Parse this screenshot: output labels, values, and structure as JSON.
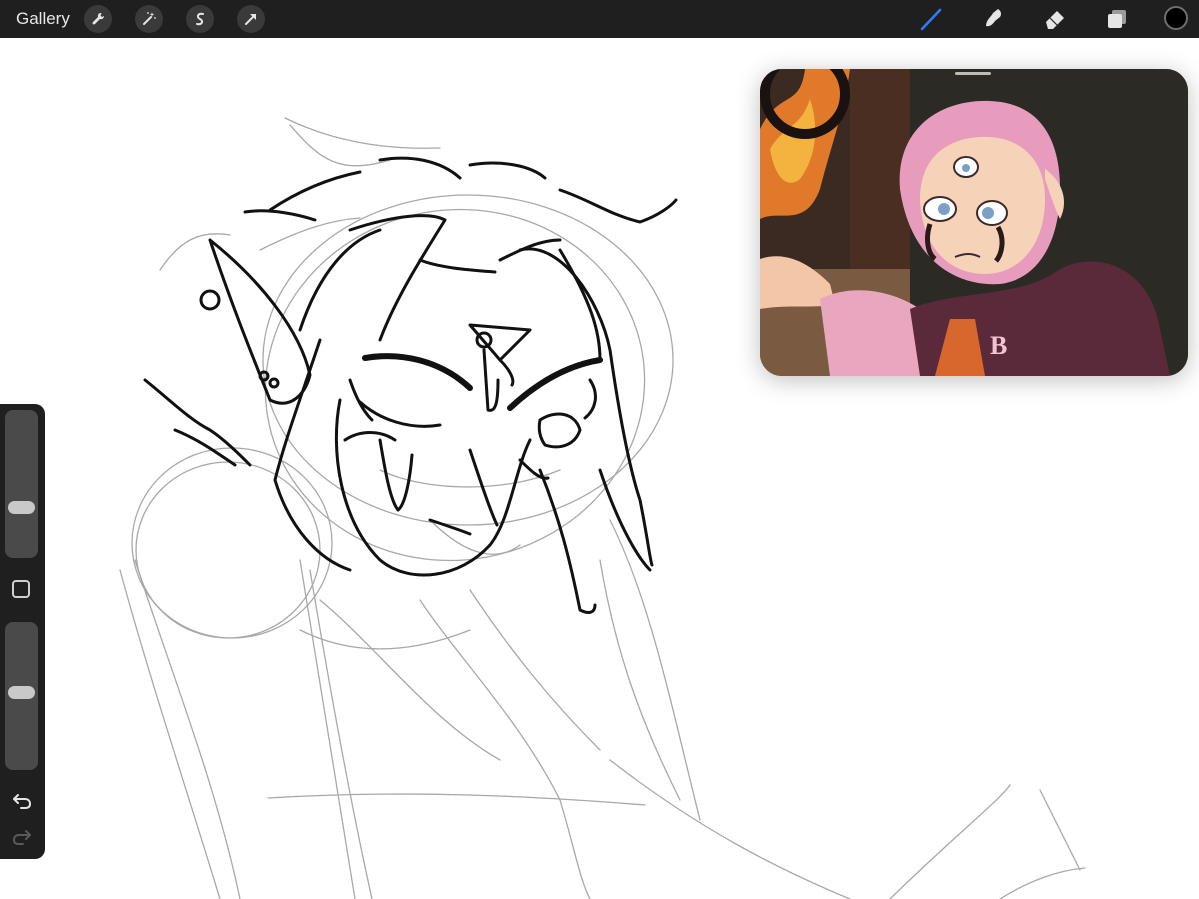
{
  "toolbar": {
    "gallery_label": "Gallery",
    "left_icons": [
      "wrench-icon",
      "magic-wand-icon",
      "selection-icon",
      "transform-arrow-icon"
    ],
    "right_icons": [
      "brush-icon",
      "smudge-icon",
      "eraser-icon",
      "layers-icon"
    ],
    "active_tool": "brush-icon",
    "active_tool_color": "#2f7bf5",
    "current_color": "#000000"
  },
  "sidebar": {
    "brush_size_level": 0.64,
    "opacity_level": 0.48,
    "icons": [
      "modify-square-icon",
      "undo-icon",
      "redo-icon"
    ]
  }
}
